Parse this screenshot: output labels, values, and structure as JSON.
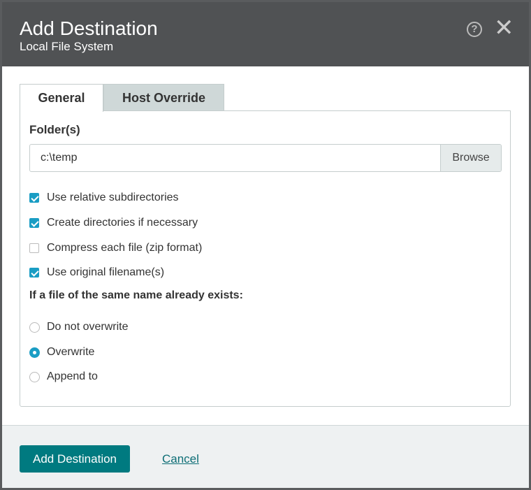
{
  "header": {
    "title": "Add Destination",
    "subtitle": "Local File System",
    "help_icon": "?",
    "close_icon": "✕"
  },
  "tabs": [
    {
      "label": "General",
      "active": true
    },
    {
      "label": "Host Override",
      "active": false
    }
  ],
  "folder": {
    "label": "Folder(s)",
    "value": "c:\\temp",
    "browse_label": "Browse"
  },
  "options": [
    {
      "label": "Use relative subdirectories",
      "checked": true
    },
    {
      "label": "Create directories if necessary",
      "checked": true
    },
    {
      "label": "Compress each file (zip format)",
      "checked": false
    },
    {
      "label": "Use original filename(s)",
      "checked": true
    }
  ],
  "exists": {
    "label": "If a file of the same name already exists:",
    "choices": [
      {
        "label": "Do not overwrite",
        "selected": false
      },
      {
        "label": "Overwrite",
        "selected": true
      },
      {
        "label": "Append to",
        "selected": false
      }
    ]
  },
  "footer": {
    "submit_label": "Add Destination",
    "cancel_label": "Cancel"
  },
  "colors": {
    "accent": "#1a9dc4",
    "button": "#007a80",
    "header": "#505254"
  }
}
